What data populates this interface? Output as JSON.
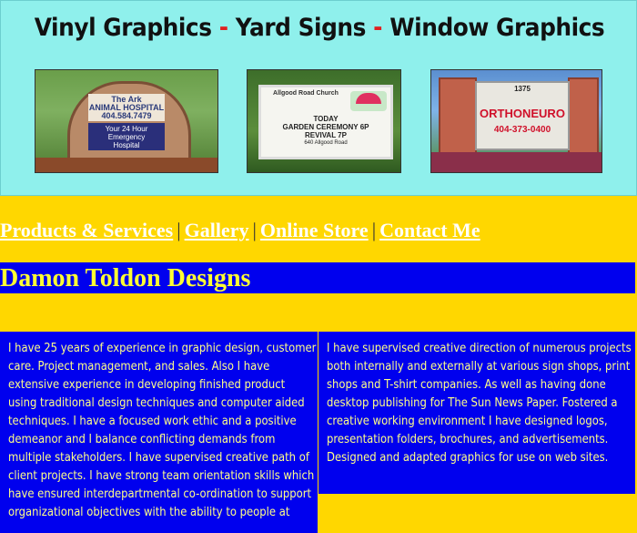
{
  "banner": {
    "title_part1": "Vinyl Graphics",
    "dash1": "-",
    "title_part2": "Yard Signs",
    "dash2": "-",
    "title_part3": "Window Graphics",
    "photo1": {
      "line1": "The Ark",
      "line2": "ANIMAL HOSPITAL",
      "line3": "404.584.7479",
      "line4": "Your 24 Hour",
      "line5": "Emergency",
      "line6": "Hospital"
    },
    "photo2": {
      "heading": "Allgood Road Church",
      "logo": "ALLGOOD ROAD CHURCH",
      "line1": "TODAY",
      "line2": "GARDEN CEREMONY 6P",
      "line3": "REVIVAL 7P",
      "line4": "640 Allgood Road"
    },
    "photo3": {
      "number": "1375",
      "name": "ORTHONEURO",
      "phone": "404-373-0400"
    }
  },
  "nav": {
    "items": [
      "Products & Services",
      "Gallery",
      "Online Store",
      "Contact Me"
    ],
    "separator": "|"
  },
  "site_title": "Damon Toldon Designs",
  "left_column": "I have 25 years of experience in graphic design, customer care. Project management, and sales. Also I have extensive experience in developing finished product using traditional design techniques and computer aided techniques. I have a focused work ethic and a positive demeanor and I balance conflicting demands from multiple stakeholders. I have supervised creative path of client projects. I have strong team orientation skills which have ensured interdepartmental co-ordination to support organizational objectives with the ability to people at",
  "right_column": "I have supervised creative direction of numerous projects both internally and externally at various sign shops, print shops and T-shirt companies. As well as having done desktop publishing for The Sun News Paper. Fostered a creative working environment I have designed logos, presentation folders, brochures, and advertisements. Designed and adapted graphics for use on web sites.",
  "colors": {
    "background": "#FFD700",
    "banner": "#8FF0EC",
    "blue": "#0000EE",
    "title_yellow": "#FFFF33",
    "text_yellow": "#FFFF88",
    "dash_red": "#E02020"
  }
}
